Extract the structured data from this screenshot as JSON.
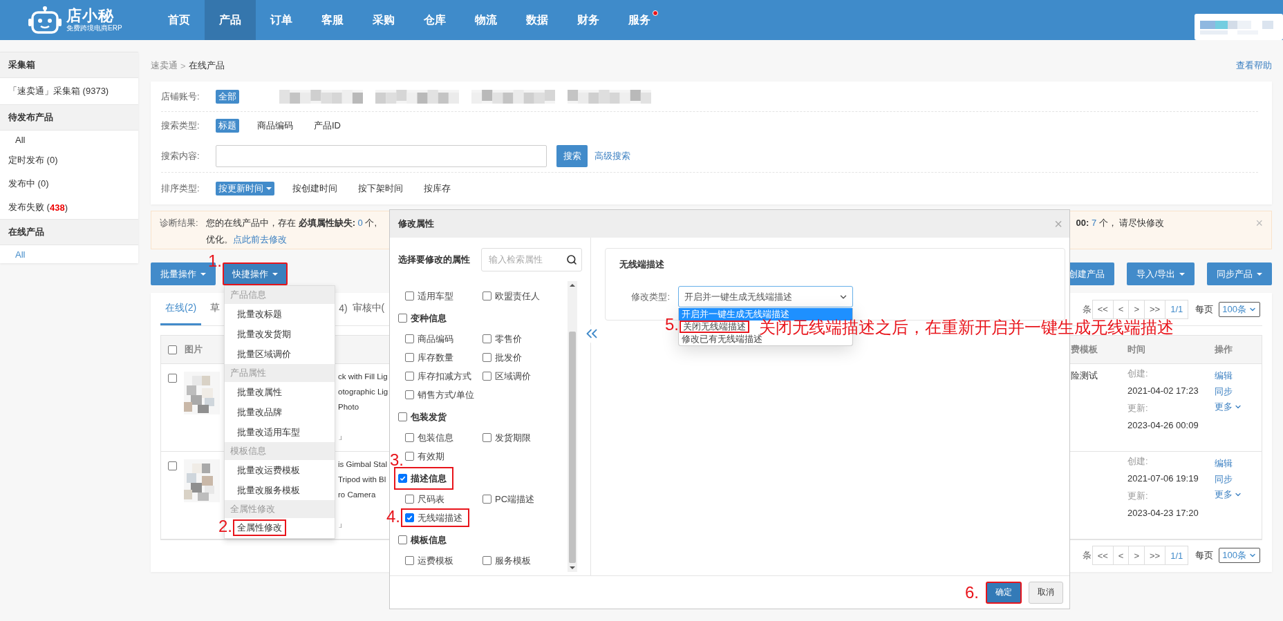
{
  "header": {
    "logo": {
      "name": "店小秘",
      "tagline": "免费跨境电商ERP"
    },
    "nav": [
      {
        "label": "首页",
        "selected": false,
        "badge": false
      },
      {
        "label": "产品",
        "selected": true,
        "badge": false
      },
      {
        "label": "订单",
        "selected": false,
        "badge": false
      },
      {
        "label": "客服",
        "selected": false,
        "badge": false
      },
      {
        "label": "采购",
        "selected": false,
        "badge": false
      },
      {
        "label": "仓库",
        "selected": false,
        "badge": false
      },
      {
        "label": "物流",
        "selected": false,
        "badge": false
      },
      {
        "label": "数据",
        "selected": false,
        "badge": false
      },
      {
        "label": "财务",
        "selected": false,
        "badge": false
      },
      {
        "label": "服务",
        "selected": false,
        "badge": true
      }
    ],
    "account": {
      "kind": "picture"
    }
  },
  "sidebar": {
    "sections": [
      {
        "title": "采集箱",
        "items": [
          {
            "label": "「速卖通」采集箱 (9373)",
            "kind": "plain",
            "selected": false
          }
        ]
      },
      {
        "title": "待发布产品",
        "items": [
          {
            "label": "All",
            "kind": "sub",
            "selected": false
          },
          {
            "label": "定时发布 (0)",
            "kind": "plain",
            "selected": false
          },
          {
            "label": "发布中 (0)",
            "kind": "plain",
            "selected": false
          },
          {
            "label": "发布失败 (",
            "count": "438",
            "suffix": ")",
            "kind": "plain",
            "selected": false
          }
        ]
      },
      {
        "title": "在线产品",
        "items": [
          {
            "label": "All",
            "kind": "sub",
            "selected": true
          }
        ]
      }
    ]
  },
  "breadcrumb": {
    "items": [
      "速卖通",
      "在线产品"
    ],
    "separator": ">"
  },
  "help_link": "查看帮助",
  "filters": {
    "rows": [
      {
        "label": "店铺账号:",
        "kind": "tags",
        "options": [
          {
            "label": "全部",
            "selected": true
          }
        ],
        "accounts": [
          {
            "kind": "picture"
          },
          {
            "kind": "picture"
          },
          {
            "kind": "picture"
          },
          {
            "kind": "picture"
          }
        ]
      },
      {
        "label": "搜索类型:",
        "kind": "tags",
        "options": [
          {
            "label": "标题",
            "selected": true
          },
          {
            "label": "商品编码",
            "selected": false
          },
          {
            "label": "产品ID",
            "selected": false
          }
        ]
      },
      {
        "label": "搜索内容:",
        "kind": "search",
        "button": "搜索",
        "link": "高级搜索"
      },
      {
        "label": "排序类型:",
        "kind": "sort",
        "options": [
          {
            "label": "按更新时间",
            "selected": true
          },
          {
            "label": "按创建时间",
            "selected": false
          },
          {
            "label": "按下架时间",
            "selected": false
          },
          {
            "label": "按库存",
            "selected": false
          }
        ]
      }
    ]
  },
  "diagnosis": {
    "label": "诊断结果:",
    "lead": [
      {
        "text": "您的在线产品中，存在 ",
        "kind": "plain"
      },
      {
        "text": "必填属性缺失:",
        "kind": "bold"
      },
      {
        "text": " 0",
        "kind": "number"
      },
      {
        "text": " 个,",
        "kind": "plain"
      }
    ],
    "tail": [
      {
        "text": "00:",
        "kind": "bold"
      },
      {
        "text": " 7",
        "kind": "number"
      },
      {
        "text": " 个， 请尽快修改",
        "kind": "plain"
      }
    ],
    "line2": "优化。",
    "link": "点此前去修改",
    "close": "×"
  },
  "toolbar": {
    "left": [
      {
        "label": "批量操作",
        "caret": true,
        "open": false
      },
      {
        "label": "快捷操作",
        "caret": true,
        "open": true,
        "step": "1.",
        "menu": [
          {
            "title": "产品信息",
            "items": [
              {
                "label": "批量改标题"
              },
              {
                "label": "批量改发货期"
              },
              {
                "label": "批量区域调价"
              }
            ]
          },
          {
            "title": "产品属性",
            "items": [
              {
                "label": "批量改属性"
              },
              {
                "label": "批量改品牌"
              },
              {
                "label": "批量改适用车型"
              }
            ]
          },
          {
            "title": "模板信息",
            "items": [
              {
                "label": "批量改运费模板"
              },
              {
                "label": "批量改服务模板"
              }
            ]
          },
          {
            "title": "全属性修改",
            "items": [
              {
                "label": "全属性修改",
                "step": "2."
              }
            ]
          }
        ]
      }
    ],
    "right": [
      {
        "label": "创建产品",
        "caret": false
      },
      {
        "label": "导入/导出",
        "caret": true
      },
      {
        "label": "同步产品",
        "caret": true
      }
    ]
  },
  "table": {
    "tabs": [
      {
        "label": "在线(2)",
        "selected": true
      },
      {
        "label": "草",
        "selected": false
      },
      {
        "label": "4)",
        "selected": false
      },
      {
        "label": "审核中(",
        "selected": false
      }
    ],
    "pager": {
      "fragment": "条",
      "buttons": [
        "<<",
        "<",
        ">",
        ">>"
      ],
      "page": "1/1",
      "per_page_label": "每页",
      "per_page": "100条"
    },
    "select_all": {
      "checked": false
    },
    "columns": [
      {
        "label": "图片"
      },
      {
        "label": "费模板"
      },
      {
        "label": "时间"
      },
      {
        "label": "操作"
      }
    ],
    "rows": [
      {
        "checked": false,
        "image": {
          "kind": "picture"
        },
        "title": [
          "ck with Fill Lig",
          "otographic Lig",
          "Photo"
        ],
        "title_end": "」",
        "freight": "险测试",
        "created_label": "创建:",
        "created": "2021-04-02 17:23",
        "updated_label": "更新:",
        "updated": "2023-04-26 00:09",
        "actions": [
          {
            "label": "编辑",
            "caret": false
          },
          {
            "label": "同步",
            "caret": false
          },
          {
            "label": "更多",
            "caret": true
          }
        ]
      },
      {
        "checked": false,
        "image": {
          "kind": "picture"
        },
        "title": [
          "is Gimbal Stal",
          "Tripod with Bl",
          "ro Camera"
        ],
        "title_end": "」",
        "created_label": "创建:",
        "created": "2021-07-06 19:19",
        "updated_label": "更新:",
        "updated": "2023-04-23 17:20",
        "actions": [
          {
            "label": "编辑",
            "caret": false
          },
          {
            "label": "同步",
            "caret": false
          },
          {
            "label": "更多",
            "caret": true
          }
        ]
      }
    ],
    "pager_bottom": {
      "fragment": "条",
      "buttons": [
        "<<",
        "<",
        ">",
        ">>"
      ],
      "page": "1/1",
      "per_page_label": "每页",
      "per_page": "100条"
    }
  },
  "modal": {
    "title": "修改属性",
    "close": "×",
    "picker": {
      "title": "选择要修改的属性",
      "search_placeholder": "输入检索属性",
      "groups": [
        {
          "items": [
            {
              "label": "适用车型",
              "checked": false
            },
            {
              "label": "欧盟责任人",
              "checked": false
            }
          ]
        },
        {
          "title": "变种信息",
          "checked": false,
          "items": [
            {
              "label": "商品编码",
              "checked": false
            },
            {
              "label": "零售价",
              "checked": false
            },
            {
              "label": "库存数量",
              "checked": false
            },
            {
              "label": "批发价",
              "checked": false
            },
            {
              "label": "库存扣减方式",
              "checked": false
            },
            {
              "label": "区域调价",
              "checked": false
            },
            {
              "label": "销售方式/单位",
              "checked": false
            }
          ]
        },
        {
          "title": "包装发货",
          "checked": false,
          "items": [
            {
              "label": "包装信息",
              "checked": false
            },
            {
              "label": "发货期限",
              "checked": false
            },
            {
              "label": "有效期",
              "checked": false
            }
          ]
        },
        {
          "title": "描述信息",
          "checked": true,
          "step": "3.",
          "items": [
            {
              "label": "尺码表",
              "checked": false
            },
            {
              "label": "PC端描述",
              "checked": false
            },
            {
              "label": "无线端描述",
              "checked": true,
              "step": "4."
            }
          ]
        },
        {
          "title": "模板信息",
          "checked": false,
          "items": [
            {
              "label": "运费模板",
              "checked": false
            },
            {
              "label": "服务模板",
              "checked": false
            }
          ]
        }
      ]
    },
    "editor": {
      "title": "无线端描述",
      "field_label": "修改类型:",
      "value": "开启并一键生成无线端描述",
      "expanded": true,
      "options": [
        {
          "label": "开启并一键生成无线端描述",
          "selected": true
        },
        {
          "label": "关闭无线端描述",
          "selected": false,
          "step": "5.",
          "note": "关闭无线端描述之后，在重新开启并一键生成无线端描述"
        },
        {
          "label": "修改已有无线端描述",
          "selected": false
        }
      ]
    },
    "footer": [
      {
        "label": "确定",
        "kind": "primary",
        "step": "6."
      },
      {
        "label": "取消",
        "kind": "default"
      }
    ]
  }
}
